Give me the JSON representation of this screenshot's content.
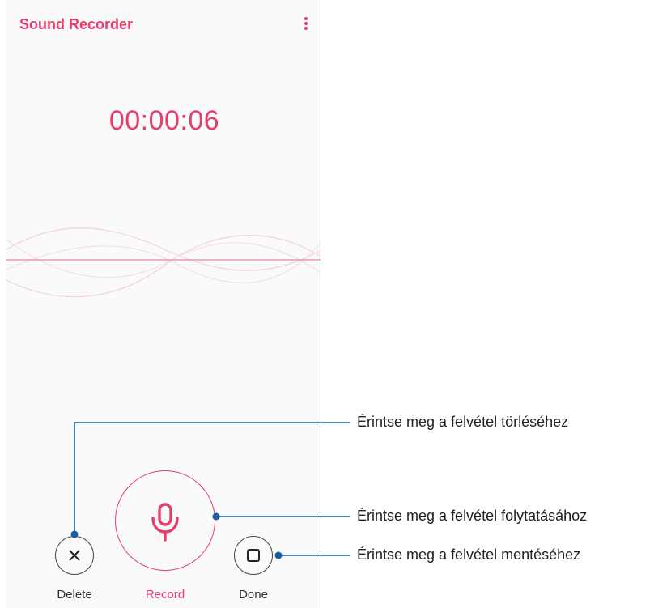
{
  "app": {
    "title": "Sound Recorder",
    "menu_icon": "more-vertical-icon"
  },
  "recorder": {
    "elapsed": "00:00:06"
  },
  "controls": {
    "delete_label": "Delete",
    "delete_icon": "close-icon",
    "record_label": "Record",
    "record_icon": "microphone-icon",
    "done_label": "Done",
    "done_icon": "stop-square-icon"
  },
  "callouts": {
    "delete": "Érintse meg a felvétel törléséhez",
    "record": "Érintse meg a felvétel folytatásához",
    "done": "Érintse meg a felvétel mentéséhez"
  },
  "colors": {
    "accent": "#e83d6a",
    "callout_line": "#1a5ea8"
  }
}
